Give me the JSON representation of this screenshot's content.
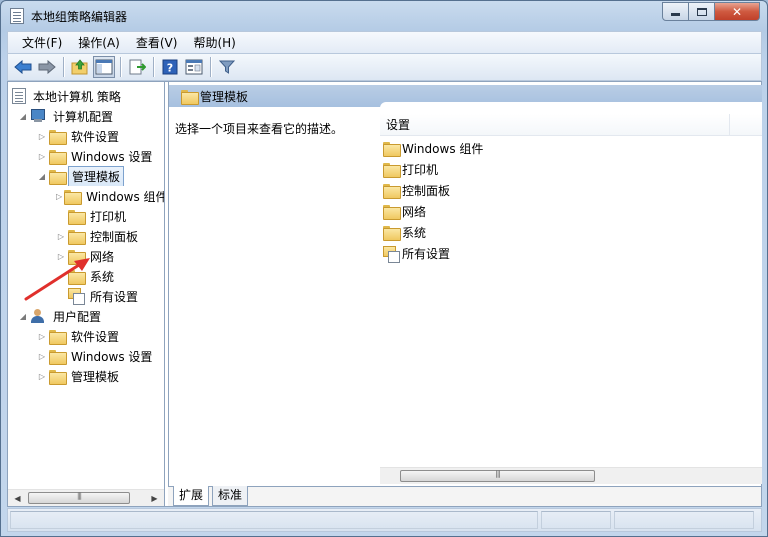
{
  "window": {
    "title": "本地组策略编辑器"
  },
  "menu": [
    "文件(F)",
    "操作(A)",
    "查看(V)",
    "帮助(H)"
  ],
  "toolbar": {
    "buttons": [
      "back-arrow-icon",
      "forward-arrow-icon",
      "up-folder-icon",
      "show-hide-tree-icon",
      "export-list-icon",
      "help-icon",
      "properties-icon",
      "filter-icon"
    ]
  },
  "tree": {
    "root": "本地计算机 策略",
    "computer_config": "计算机配置",
    "cc_software": "软件设置",
    "cc_windows": "Windows 设置",
    "cc_admin": "管理模板",
    "admin_windows": "Windows 组件",
    "admin_printer": "打印机",
    "admin_control": "控制面板",
    "admin_network": "网络",
    "admin_system": "系统",
    "admin_all": "所有设置",
    "user_config": "用户配置",
    "uc_software": "软件设置",
    "uc_windows": "Windows 设置",
    "uc_admin": "管理模板"
  },
  "right": {
    "header": "管理模板",
    "description": "选择一个项目来查看它的描述。",
    "column": "设置",
    "items": [
      "Windows 组件",
      "打印机",
      "控制面板",
      "网络",
      "系统",
      "所有设置"
    ]
  },
  "tabs": [
    "扩展",
    "标准"
  ],
  "colors": {
    "annotation_arrow": "#e0302c",
    "header_band": "#a9c2df"
  }
}
